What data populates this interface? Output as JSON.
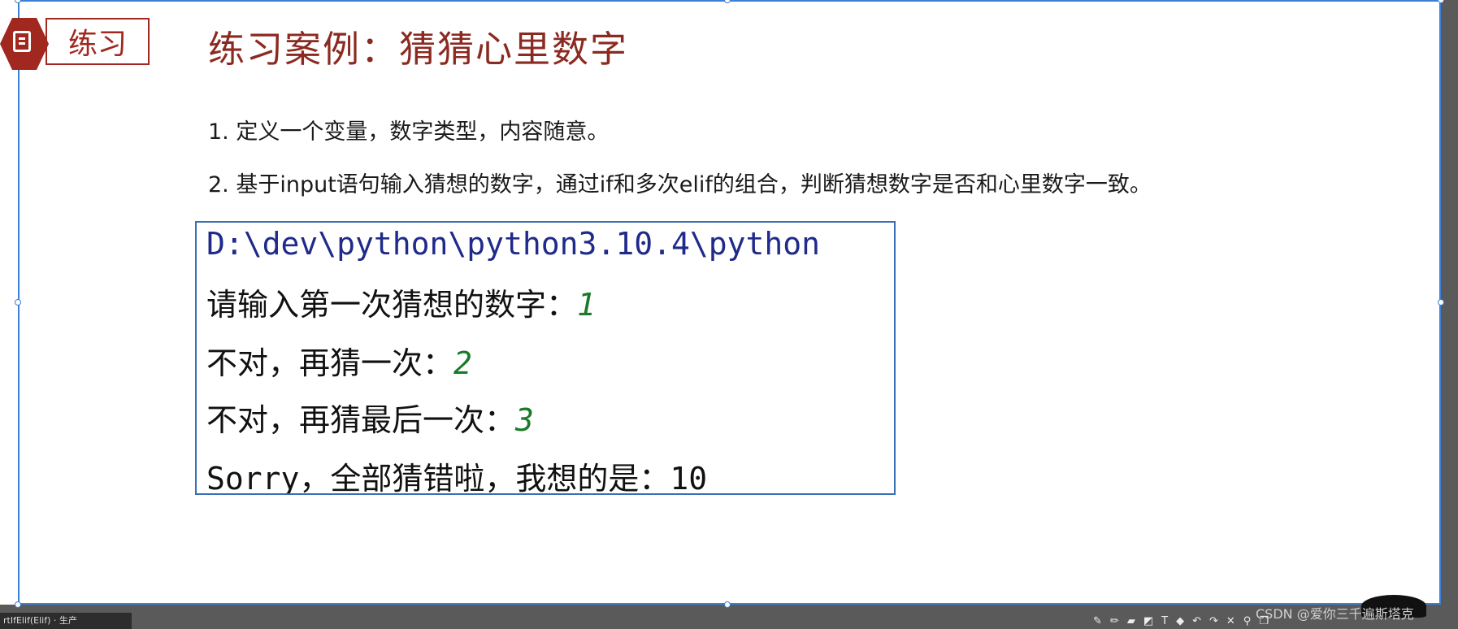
{
  "badge": {
    "label": "练习"
  },
  "title": "练习案例：猜猜心里数字",
  "steps": [
    "1. 定义一个变量，数字类型，内容随意。",
    "2. 基于input语句输入猜想的数字，通过if和多次elif的组合，判断猜想数字是否和心里数字一致。"
  ],
  "console": {
    "path": "D:\\dev\\python\\python3.10.4\\python",
    "lines": [
      {
        "prompt": "请输入第一次猜想的数字：",
        "answer": "1"
      },
      {
        "prompt": "不对，再猜一次：",
        "answer": "2"
      },
      {
        "prompt": "不对，再猜最后一次：",
        "answer": "3"
      }
    ],
    "final_prefix": "Sorry",
    "final_text": "，全部猜错啦，我想的是：",
    "final_value": "10"
  },
  "taskbar": {
    "text": "rtIfElif(Elif) · 生产"
  },
  "watermark": "CSDN @爱你三千遍斯塔克",
  "toolbar_icons": [
    "pen-icon",
    "pencil-icon",
    "marker-icon",
    "eraser-icon",
    "text-icon",
    "highlight-icon",
    "undo-icon",
    "redo-icon",
    "close-icon",
    "pin-icon",
    "copy-icon"
  ],
  "colors": {
    "accent": "#a1281f",
    "title": "#8b2a21",
    "selection": "#3b7fd6",
    "answer": "#1a7a28",
    "path": "#1f2a8a"
  }
}
